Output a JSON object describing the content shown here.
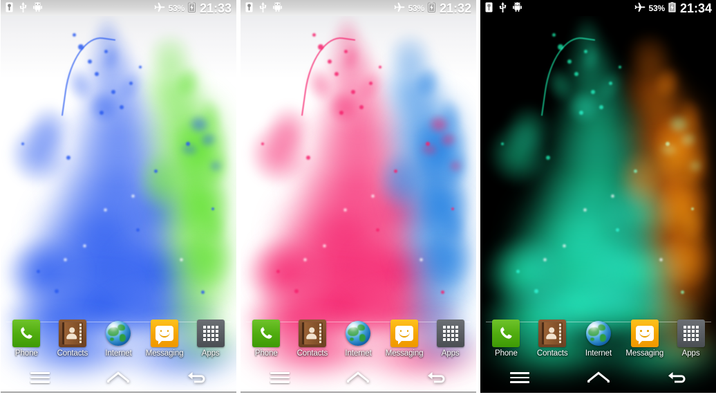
{
  "screens": [
    {
      "id": "screen-blue-green",
      "theme": "light",
      "status": {
        "icons_left": [
          "sim-card-icon",
          "usb-icon",
          "android-bug-icon"
        ],
        "airplane_icon": "airplane-mode-icon",
        "battery_percent": "53%",
        "battery_icon": "battery-charging-icon",
        "clock": "21:33"
      },
      "wallpaper": {
        "name": "blue-green-ink-splash",
        "background": "#ffffff",
        "primary_color": "#2b5cf0",
        "secondary_color": "#5ce02a"
      },
      "dock": [
        {
          "label": "Phone",
          "icon": "phone-icon"
        },
        {
          "label": "Contacts",
          "icon": "contacts-icon"
        },
        {
          "label": "Internet",
          "icon": "internet-globe-icon"
        },
        {
          "label": "Messaging",
          "icon": "messaging-icon"
        },
        {
          "label": "Apps",
          "icon": "apps-grid-icon"
        }
      ],
      "nav": [
        {
          "label": "Menu",
          "icon": "menu-icon"
        },
        {
          "label": "Home",
          "icon": "home-icon"
        },
        {
          "label": "Back",
          "icon": "back-icon"
        }
      ]
    },
    {
      "id": "screen-pink-blue",
      "theme": "light",
      "status": {
        "icons_left": [
          "sim-card-icon",
          "usb-icon",
          "android-bug-icon"
        ],
        "airplane_icon": "airplane-mode-icon",
        "battery_percent": "53%",
        "battery_icon": "battery-charging-icon",
        "clock": "21:32"
      },
      "wallpaper": {
        "name": "pink-blue-ink-splash",
        "background": "#ffffff",
        "primary_color": "#f5236e",
        "secondary_color": "#1679e0"
      },
      "dock": [
        {
          "label": "Phone",
          "icon": "phone-icon"
        },
        {
          "label": "Contacts",
          "icon": "contacts-icon"
        },
        {
          "label": "Internet",
          "icon": "internet-globe-icon"
        },
        {
          "label": "Messaging",
          "icon": "messaging-icon"
        },
        {
          "label": "Apps",
          "icon": "apps-grid-icon"
        }
      ],
      "nav": [
        {
          "label": "Menu",
          "icon": "menu-icon"
        },
        {
          "label": "Home",
          "icon": "home-icon"
        },
        {
          "label": "Back",
          "icon": "back-icon"
        }
      ]
    },
    {
      "id": "screen-green-orange",
      "theme": "dark",
      "status": {
        "icons_left": [
          "sim-card-icon",
          "usb-icon",
          "android-bug-icon"
        ],
        "airplane_icon": "airplane-mode-icon",
        "battery_percent": "53%",
        "battery_icon": "battery-charging-icon",
        "clock": "21:34"
      },
      "wallpaper": {
        "name": "green-orange-ink-splash",
        "background": "#000000",
        "primary_color": "#17d69a",
        "secondary_color": "#ef6a08"
      },
      "dock": [
        {
          "label": "Phone",
          "icon": "phone-icon"
        },
        {
          "label": "Contacts",
          "icon": "contacts-icon"
        },
        {
          "label": "Internet",
          "icon": "internet-globe-icon"
        },
        {
          "label": "Messaging",
          "icon": "messaging-icon"
        },
        {
          "label": "Apps",
          "icon": "apps-grid-icon"
        }
      ],
      "nav": [
        {
          "label": "Menu",
          "icon": "menu-icon"
        },
        {
          "label": "Home",
          "icon": "home-icon"
        },
        {
          "label": "Back",
          "icon": "back-icon"
        }
      ]
    }
  ]
}
